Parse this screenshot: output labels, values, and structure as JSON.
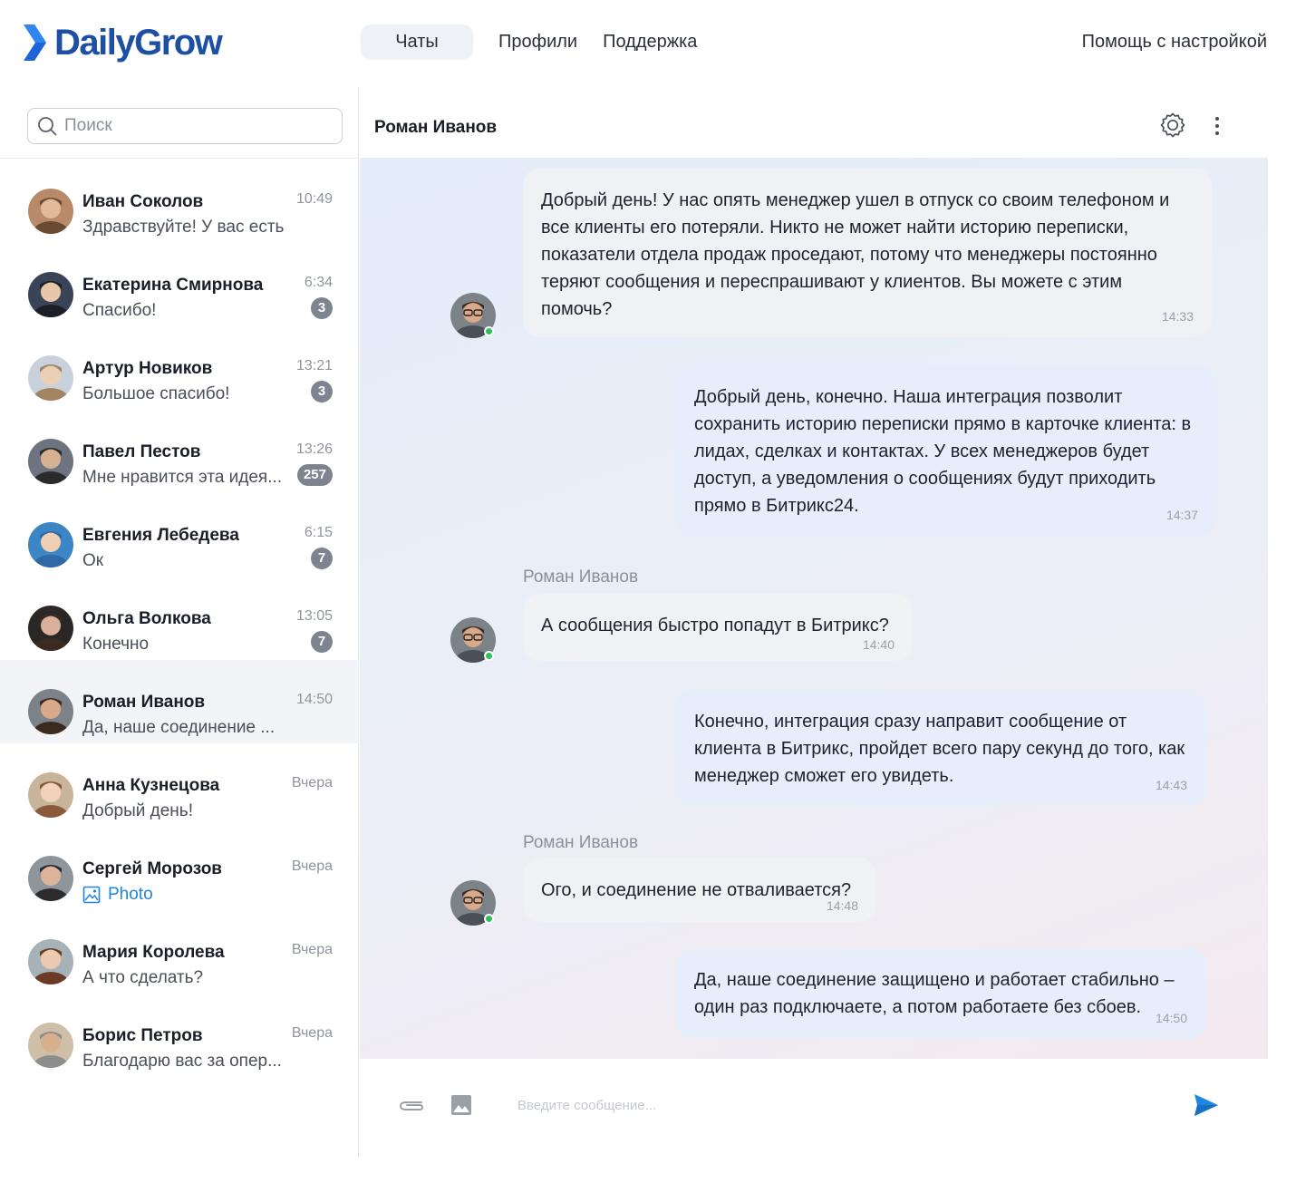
{
  "app": {
    "name": "DailyGrow"
  },
  "nav": {
    "items": [
      {
        "label": "Чаты",
        "active": true
      },
      {
        "label": "Профили"
      },
      {
        "label": "Поддержка"
      }
    ],
    "help_label": "Помощь с настройкой"
  },
  "search": {
    "placeholder": "Поиск",
    "value": ""
  },
  "chats": [
    {
      "name": "Иван Соколов",
      "preview": "Здравствуйте! У вас есть ...",
      "time": "10:49",
      "badge": ""
    },
    {
      "name": "Екатерина Смирнова",
      "preview": "Спасибо!",
      "time": "6:34",
      "badge": "3"
    },
    {
      "name": "Артур Новиков",
      "preview": "Большое спасибо!",
      "time": "13:21",
      "badge": "3"
    },
    {
      "name": "Павел Пестов",
      "preview": "Мне нравится эта идея...",
      "time": "13:26",
      "badge": "257"
    },
    {
      "name": "Евгения Лебедева",
      "preview": "Ок",
      "time": "6:15",
      "badge": "7"
    },
    {
      "name": "Ольга Волкова",
      "preview": "Конечно",
      "time": "13:05",
      "badge": "7"
    },
    {
      "name": "Роман Иванов",
      "preview": "Да, наше соединение ...",
      "time": "14:50",
      "badge": "",
      "active": true
    },
    {
      "name": "Анна Кузнецова",
      "preview": "Добрый день!",
      "time": "Вчера",
      "badge": ""
    },
    {
      "name": "Сергей Морозов",
      "preview": "Photo",
      "time": "Вчера",
      "badge": "",
      "photo": true
    },
    {
      "name": "Мария Королева",
      "preview": "А что сделать?",
      "time": "Вчера",
      "badge": ""
    },
    {
      "name": "Борис Петров",
      "preview": "Благодарю вас за опер...",
      "time": "Вчера",
      "badge": ""
    }
  ],
  "conversation": {
    "title": "Роман Иванов",
    "messages": [
      {
        "dir": "in",
        "text": "Добрый день! У нас опять менеджер ушел в отпуск со своим телефоном и все клиенты его потеряли. Никто не может найти историю переписки, показатели отдела продаж проседают, потому что менеджеры постоянно теряют сообщения и переспрашивают у клиентов. Вы можете с этим помочь?",
        "time": "14:33"
      },
      {
        "dir": "out",
        "text": "Добрый день, конечно. Наша интеграция позволит сохранить историю переписки прямо в карточке клиента: в лидах, сделках и контактах. У всех менеджеров будет доступ, а уведомления о сообщениях будут приходить прямо в Битрикс24.",
        "time": "14:37"
      },
      {
        "dir": "in",
        "sender": "Роман Иванов",
        "text": "А сообщения быстро попадут в Битрикс?",
        "time": "14:40"
      },
      {
        "dir": "out",
        "text": "Конечно, интеграция сразу направит сообщение от клиента в Битрикс, пройдет всего пару секунд до того, как менеджер сможет его увидеть.",
        "time": "14:43"
      },
      {
        "dir": "in",
        "sender": "Роман Иванов",
        "text": "Ого, и соединение не отваливается?",
        "time": "14:48"
      },
      {
        "dir": "out",
        "text": "Да, наше соединение защищено и работает стабильно – один раз подключаете, а потом работаете без сбоев.",
        "time": "14:50"
      }
    ]
  },
  "composer": {
    "placeholder": "Введите сообщение...",
    "value": ""
  },
  "colors": {
    "brand": "#1d4fa3",
    "accent": "#1f86e0",
    "online": "#2fc157",
    "badge": "#7e848f"
  },
  "icons": [
    "logo-chevron-icon",
    "search-icon",
    "gear-icon",
    "more-vertical-icon",
    "photo-icon",
    "paperclip-icon",
    "image-icon",
    "send-icon"
  ]
}
